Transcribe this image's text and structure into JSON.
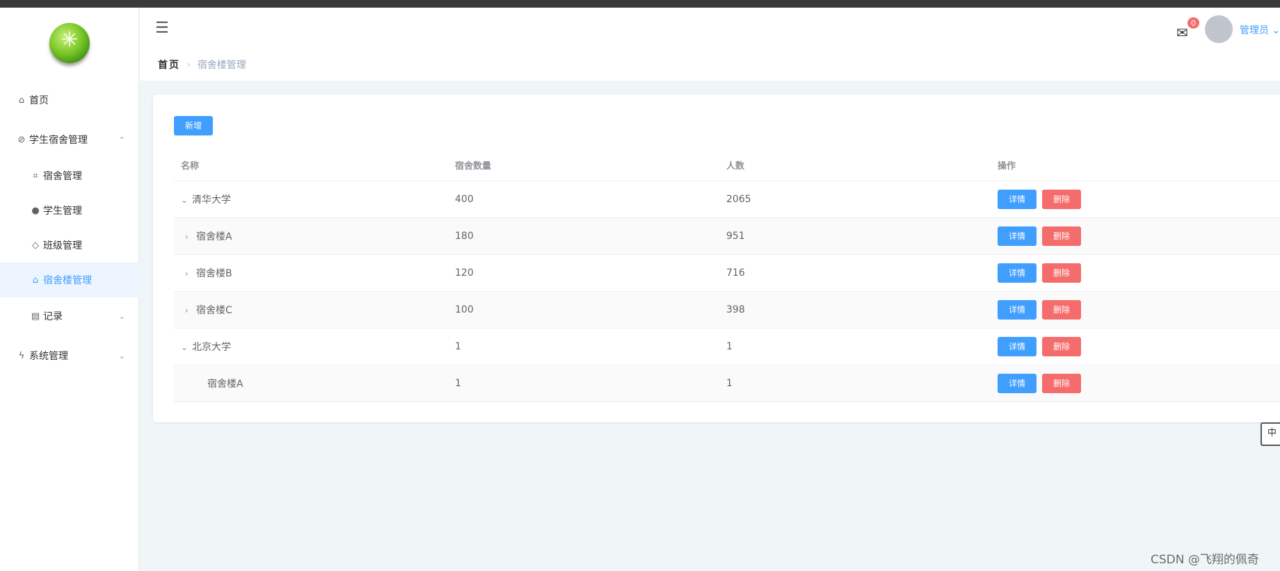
{
  "sidebar": {
    "items": [
      {
        "label": "首页",
        "icon": "home-icon",
        "icon_glyph": "⌂"
      },
      {
        "label": "学生宿舍管理",
        "icon": "paperclip-icon",
        "icon_glyph": "⊘",
        "arrow": "⌃"
      },
      {
        "label": "宿舍管理",
        "icon": "crop-icon",
        "icon_glyph": "⌗"
      },
      {
        "label": "学生管理",
        "icon": "user-icon",
        "icon_glyph": "●"
      },
      {
        "label": "班级管理",
        "icon": "graduation-icon",
        "icon_glyph": "◇"
      },
      {
        "label": "宿舍楼管理",
        "icon": "house-icon",
        "icon_glyph": "⌂"
      },
      {
        "label": "记录",
        "icon": "document-icon",
        "icon_glyph": "▤",
        "arrow": "⌄"
      },
      {
        "label": "系统管理",
        "icon": "lightning-icon",
        "icon_glyph": "ϟ",
        "arrow": "⌄"
      }
    ]
  },
  "header": {
    "hamburger_glyph": "☰",
    "breadcrumb": {
      "home": "首页",
      "separator": "›",
      "current": "宿舍楼管理"
    },
    "mail_glyph": "✉",
    "mail_count": "0",
    "username": "管理员",
    "username_arrow": "⌄"
  },
  "toolbar": {
    "new_label": "新增"
  },
  "table": {
    "columns": [
      "名称",
      "宿舍数量",
      "人数",
      "操作"
    ],
    "detail_label": "详情",
    "delete_label": "删除",
    "rows": [
      {
        "caret": "⌄",
        "name": "清华大学",
        "count": "400",
        "people": "2065"
      },
      {
        "caret": "›",
        "name": "宿舍楼A",
        "count": "180",
        "people": "951"
      },
      {
        "caret": "›",
        "name": "宿舍楼B",
        "count": "120",
        "people": "716"
      },
      {
        "caret": "›",
        "name": "宿舍楼C",
        "count": "100",
        "people": "398"
      },
      {
        "caret": "⌄",
        "name": "北京大学",
        "count": "1",
        "people": "1"
      },
      {
        "caret": "",
        "name": "宿舍楼A",
        "count": "1",
        "people": "1"
      }
    ]
  },
  "edge_widget": "中",
  "watermark": "CSDN @飞翔的佩奇",
  "colors": {
    "primary": "#409eff",
    "danger": "#f56c6c",
    "background": "#f0f6f7"
  }
}
